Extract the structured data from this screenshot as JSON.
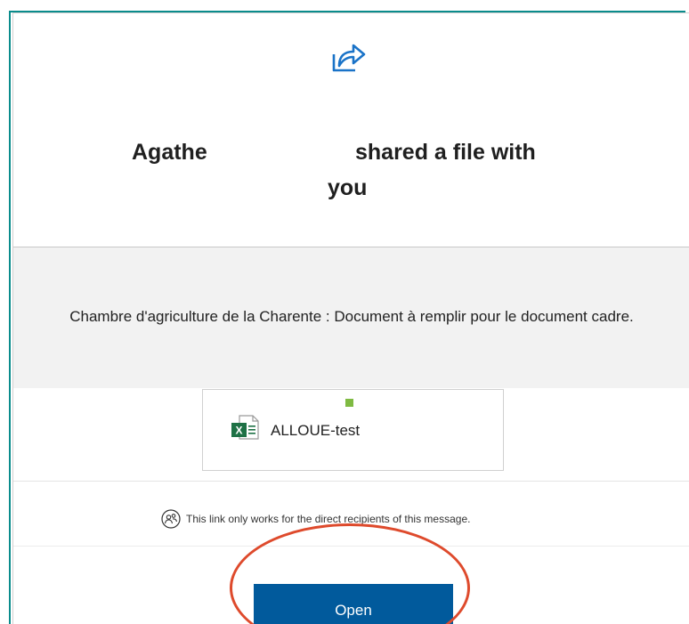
{
  "header": {
    "sender_name": "Agathe",
    "action_text": "shared a file with",
    "you_text": "you",
    "icon": "share-icon"
  },
  "message": {
    "text": "Chambre d'agriculture de la Charente : Document à remplir pour le document cadre."
  },
  "file": {
    "name": "ALLOUE-test",
    "icon": "excel-icon",
    "icon_label": "X"
  },
  "notice": {
    "text": "This link only works for the direct recipients of this message.",
    "icon": "people-icon"
  },
  "actions": {
    "open_label": "Open"
  },
  "colors": {
    "accent": "#015a9c",
    "share_icon": "#1a73c8",
    "excel_green": "#1e7145",
    "presence": "#7fba42",
    "annotation_ring": "#de4a2c"
  }
}
